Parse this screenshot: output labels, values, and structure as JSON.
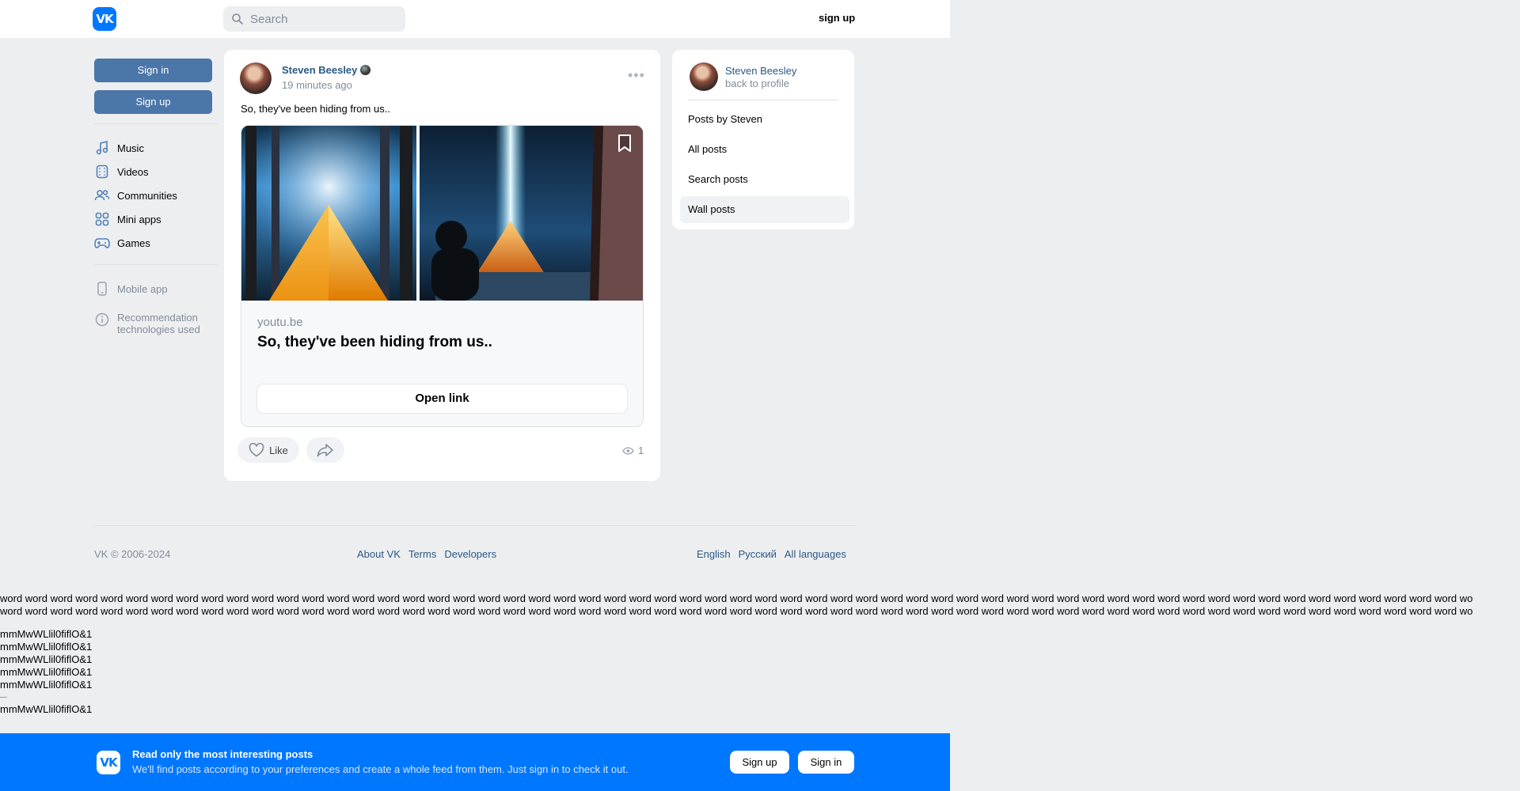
{
  "header": {
    "logo_text": "VK",
    "search_placeholder": "Search",
    "signup_label": "sign up"
  },
  "left_sidebar": {
    "signin_label": "Sign in",
    "signup_label": "Sign up",
    "nav": [
      {
        "label": "Music",
        "icon": "music-note-icon"
      },
      {
        "label": "Videos",
        "icon": "video-icon"
      },
      {
        "label": "Communities",
        "icon": "users-icon"
      },
      {
        "label": "Mini apps",
        "icon": "apps-grid-icon"
      },
      {
        "label": "Games",
        "icon": "gamepad-icon"
      }
    ],
    "mobile_app": "Mobile app",
    "recommendation": "Recommendation technologies used"
  },
  "post": {
    "author": "Steven Beesley",
    "time": "19 minutes ago",
    "text": "So, they've been hiding from us..",
    "link": {
      "domain": "youtu.be",
      "title": "So, they've been hiding from us..",
      "button": "Open link"
    },
    "like_label": "Like",
    "views": "1"
  },
  "right_panel": {
    "name": "Steven Beesley",
    "back": "back to profile",
    "items": [
      {
        "label": "Posts by Steven"
      },
      {
        "label": "All posts"
      },
      {
        "label": "Search posts"
      },
      {
        "label": "Wall posts"
      }
    ]
  },
  "footer": {
    "copyright": "VK © 2006-2024",
    "links": [
      "About VK",
      "Terms",
      "Developers"
    ],
    "languages": [
      "English",
      "Русский",
      "All languages"
    ]
  },
  "test_text": {
    "word_line_1": "word word word word word word word word word word word word word word word word word word word word word word word word word word word word word word word word word word word word word word word word word word word word word word word word word word word word word word word word word word wo",
    "word_line_2": "word word word word word word word word word word word word word word word word word word word word word word word word word word word word word word word word word word word word word word word word word word word word word word word word word word word word word word word word word word wo",
    "glyph_line": "mmMwWLlil0fiflO&1"
  },
  "banner": {
    "logo_text": "VK",
    "title": "Read only the most interesting posts",
    "subtitle": "We'll find posts according to your preferences and create a whole feed from them. Just sign in to check it out.",
    "signup": "Sign up",
    "signin": "Sign in"
  }
}
